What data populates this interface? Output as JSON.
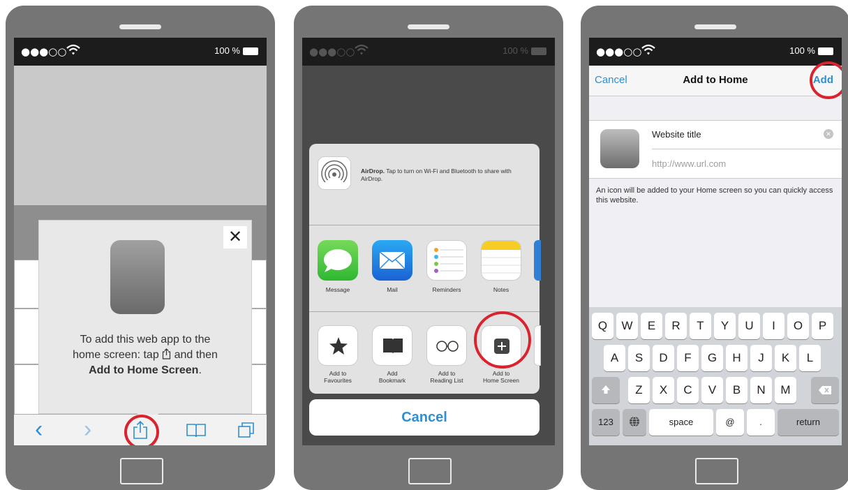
{
  "status": {
    "signal": "●●●○○",
    "battery": "100 %"
  },
  "step1": {
    "instruction_line1": "To add this web app to the",
    "instruction_line2_pre": "home screen: tap",
    "instruction_line2_post": "and then",
    "instruction_bold": "Add to Home Screen",
    "instruction_end": ".",
    "close_glyph": "✕",
    "toolbar": {
      "back": "‹",
      "forward": "›"
    }
  },
  "step2": {
    "airdrop_title": "AirDrop.",
    "airdrop_text": "Tap to turn on Wi-Fi and Bluetooth to share with AirDrop.",
    "apps": [
      {
        "label": "Message"
      },
      {
        "label": "Mail"
      },
      {
        "label": "Reminders"
      },
      {
        "label": "Notes"
      }
    ],
    "actions": [
      {
        "label1": "Add to",
        "label2": "Favourites"
      },
      {
        "label1": "Add",
        "label2": "Bookmark"
      },
      {
        "label1": "Add to",
        "label2": "Reading List"
      },
      {
        "label1": "Add to",
        "label2": "Home Screen"
      }
    ],
    "cancel": "Cancel"
  },
  "step3": {
    "nav": {
      "cancel": "Cancel",
      "title": "Add to Home",
      "add": "Add"
    },
    "website_title": "Website title",
    "url": "http://www.url.com",
    "description": "An icon will be added to your Home screen so you can quickly access this website.",
    "keyboard": {
      "row1": [
        "Q",
        "W",
        "E",
        "R",
        "T",
        "Y",
        "U",
        "I",
        "O",
        "P"
      ],
      "row2": [
        "A",
        "S",
        "D",
        "F",
        "G",
        "H",
        "J",
        "K",
        "L"
      ],
      "row3": [
        "Z",
        "X",
        "C",
        "V",
        "B",
        "N",
        "M"
      ],
      "numbers": "123",
      "space": "space",
      "at": "@",
      "dot": ".",
      "return": "return"
    }
  },
  "colors": {
    "accent": "#2f8fd0",
    "highlight_ring": "#d9232e",
    "phone_body": "#757575"
  }
}
